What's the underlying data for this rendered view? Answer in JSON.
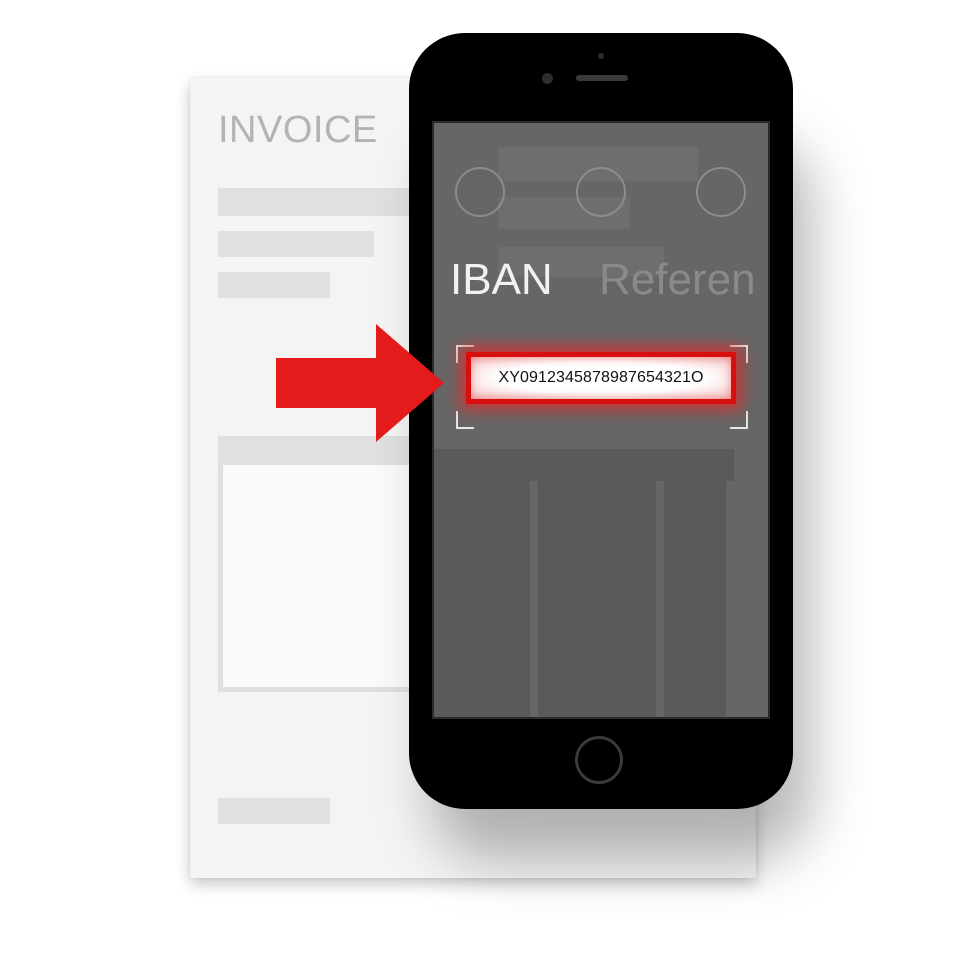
{
  "invoice": {
    "title": "INVOICE"
  },
  "phone": {
    "tabs": [
      {
        "label": "IBAN",
        "active": true
      },
      {
        "label": "Referen",
        "active": false
      }
    ],
    "progress_steps": 3,
    "scanned_iban": "XY0912345878987654321O"
  },
  "colors": {
    "highlight": "#d80f0f",
    "arrow": "#e31b1b",
    "screen": "#666666",
    "paper": "#f4f4f4"
  },
  "icons": [
    "arrow-right-icon",
    "home-button-icon"
  ]
}
